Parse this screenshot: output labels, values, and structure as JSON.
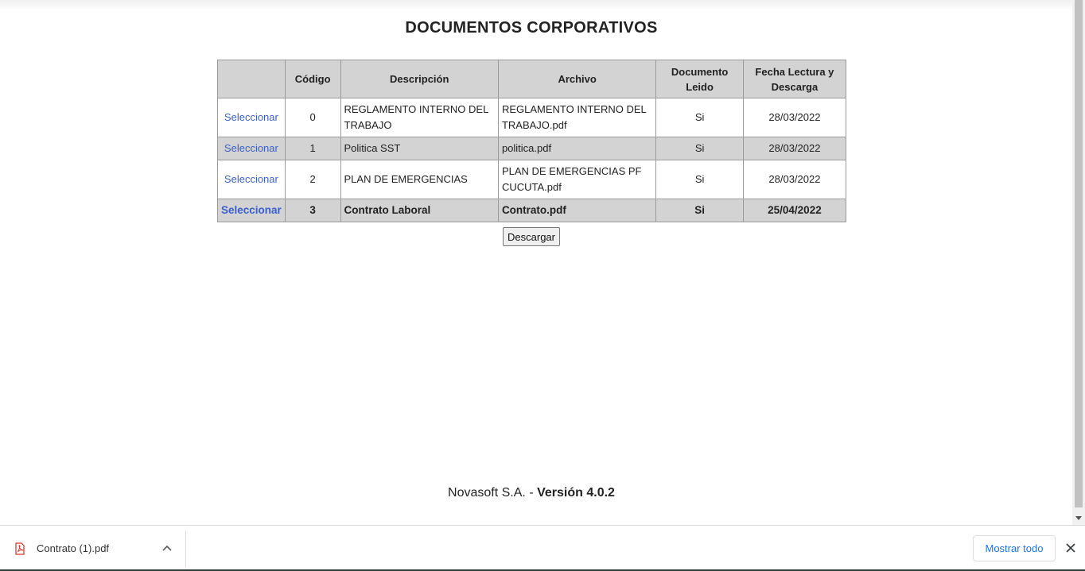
{
  "page": {
    "title": "DOCUMENTOS CORPORATIVOS"
  },
  "table": {
    "headers": [
      "",
      "Código",
      "Descripción",
      "Archivo",
      "Documento Leido",
      "Fecha Lectura y Descarga"
    ],
    "rows": [
      {
        "select": "Seleccionar",
        "code": "0",
        "description": "REGLAMENTO INTERNO DEL TRABAJO",
        "file": "REGLAMENTO INTERNO DEL TRABAJO.pdf",
        "read": "Si",
        "date": "28/03/2022"
      },
      {
        "select": "Seleccionar",
        "code": "1",
        "description": "Politica SST",
        "file": "politica.pdf",
        "read": "Si",
        "date": "28/03/2022"
      },
      {
        "select": "Seleccionar",
        "code": "2",
        "description": "PLAN DE EMERGENCIAS",
        "file": "PLAN DE EMERGENCIAS PF CUCUTA.pdf",
        "read": "Si",
        "date": "28/03/2022"
      },
      {
        "select": "Seleccionar",
        "code": "3",
        "description": "Contrato Laboral",
        "file": "Contrato.pdf",
        "read": "Si",
        "date": "25/04/2022"
      }
    ]
  },
  "actions": {
    "download_label": "Descargar"
  },
  "footer": {
    "company": "Novasoft S.A. - ",
    "version": "Versión 4.0.2"
  },
  "download_shelf": {
    "file_name": "Contrato (1).pdf",
    "show_all_label": "Mostrar todo",
    "link_color": "#1a73e8"
  },
  "colors": {
    "link": "#3a5fcd",
    "header_bg": "#d3d3d3"
  }
}
